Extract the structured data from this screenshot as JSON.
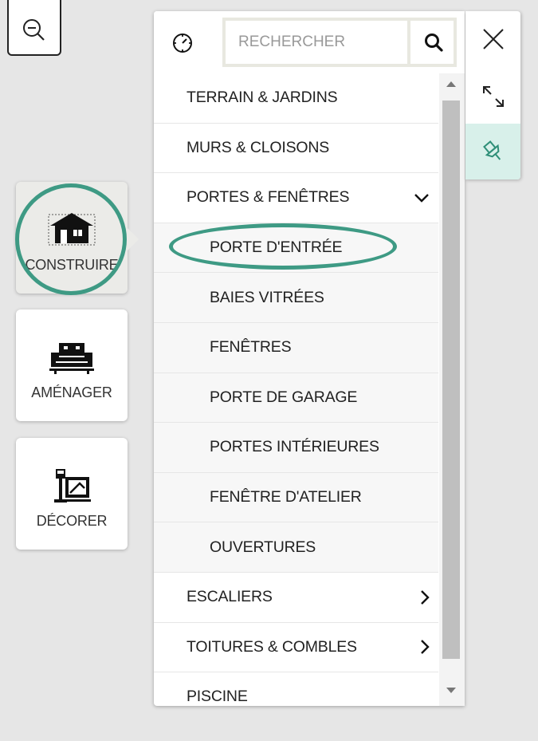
{
  "search": {
    "placeholder": "RECHERCHER"
  },
  "sidebar": {
    "items": [
      {
        "label": "CONSTRUIRE",
        "icon": "house-icon",
        "active": true
      },
      {
        "label": "AMÉNAGER",
        "icon": "sofa-icon",
        "active": false
      },
      {
        "label": "DÉCORER",
        "icon": "lamp-frame-icon",
        "active": false
      }
    ]
  },
  "menu": {
    "items": [
      {
        "label": "TERRAIN & JARDINS"
      },
      {
        "label": "MURS & CLOISONS"
      },
      {
        "label": "PORTES & FENÊTRES",
        "chevron": "down"
      },
      {
        "label": "PORTE D'ENTRÉE"
      },
      {
        "label": "BAIES VITRÉES"
      },
      {
        "label": "FENÊTRES"
      },
      {
        "label": "PORTE DE GARAGE"
      },
      {
        "label": "PORTES INTÉRIEURES"
      },
      {
        "label": "FENÊTRE D'ATELIER"
      },
      {
        "label": "OUVERTURES"
      },
      {
        "label": "ESCALIERS",
        "chevron": "right"
      },
      {
        "label": "TOITURES & COMBLES",
        "chevron": "right"
      },
      {
        "label": "PISCINE"
      }
    ]
  },
  "tools": [
    "close-icon",
    "expand-icon",
    "pin-icon"
  ],
  "colors": {
    "highlight": "#3e9a84",
    "pin_bg": "#d8f0ea",
    "background": "#e6e6e6"
  }
}
